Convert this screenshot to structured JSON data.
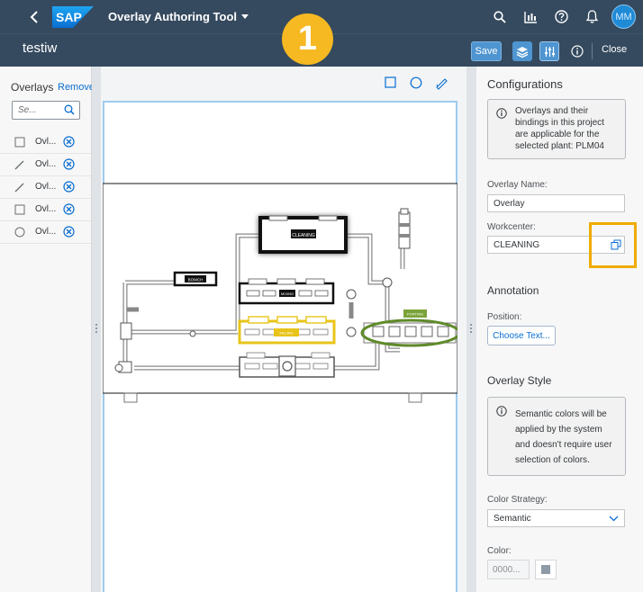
{
  "shell": {
    "logo": "SAP",
    "app_title": "Overlay Authoring Tool",
    "avatar_initials": "MM",
    "icons": [
      "search-icon",
      "chart-icon",
      "help-icon",
      "bell-icon"
    ]
  },
  "header": {
    "page_title": "testiw",
    "save_label": "Save",
    "close_label": "Close"
  },
  "step_badge": "1",
  "overlays_panel": {
    "title": "Overlays",
    "remove_label": "Remove",
    "search_placeholder": "Se...",
    "items": [
      {
        "type": "rectangle",
        "name": "Ovl..."
      },
      {
        "type": "freehand",
        "name": "Ovl..."
      },
      {
        "type": "freehand",
        "name": "Ovl..."
      },
      {
        "type": "rectangle",
        "name": "Ovl..."
      },
      {
        "type": "circle",
        "name": "Ovl..."
      }
    ]
  },
  "canvas": {
    "tools": [
      "rectangle-tool",
      "circle-tool",
      "freehand-tool"
    ],
    "labels": {
      "cleaning": "CLEANING",
      "small1": "BOMCH",
      "small2": "MIXING",
      "small3": "FILLING",
      "small4": "PORTING"
    }
  },
  "configurations": {
    "title": "Configurations",
    "info_text": "Overlays and their bindings in this project are applicable for the selected plant: PLM04",
    "overlay_name_label": "Overlay Name:",
    "overlay_name_value": "Overlay",
    "workcenter_label": "Workcenter:",
    "workcenter_value": "CLEANING",
    "annotation_title": "Annotation",
    "position_label": "Position:",
    "choose_text_label": "Choose Text...",
    "overlay_style_title": "Overlay Style",
    "style_info_text": "Semantic colors will be applied by the system and doesn't require user selection of colors.",
    "color_strategy_label": "Color Strategy:",
    "color_strategy_value": "Semantic",
    "color_label": "Color:",
    "color_value": "0000..."
  },
  "colors": {
    "shell": "#354a5f",
    "accent": "#4e95d1",
    "highlight": "#f0ab00",
    "badge": "#f6b922"
  }
}
